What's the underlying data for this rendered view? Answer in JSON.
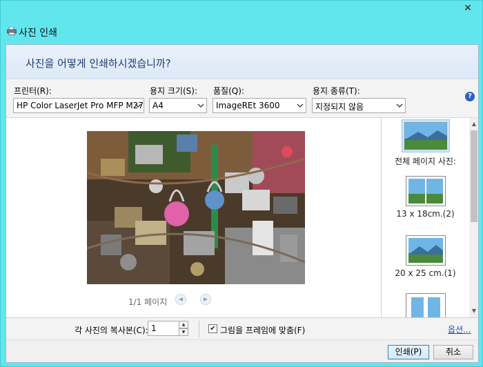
{
  "window": {
    "title": "사진 인쇄",
    "close_glyph": "✕"
  },
  "header": {
    "question": "사진을 어떻게 인쇄하시겠습니까?"
  },
  "controls": {
    "printer": {
      "label": "프린터(R):",
      "value": "HP Color LaserJet Pro MFP M277"
    },
    "paper_size": {
      "label": "용지 크기(S):",
      "value": "A4"
    },
    "quality": {
      "label": "품질(Q):",
      "value": "ImageREt 3600"
    },
    "paper_type": {
      "label": "용지 종류(T):",
      "value": "지정되지 않음"
    },
    "help": "?"
  },
  "preview": {
    "page_indicator": "1/1 페이지"
  },
  "layouts": [
    {
      "label": "전체 페이지 사진:"
    },
    {
      "label": "13 x 18cm.(2)"
    },
    {
      "label": "20 x 25 cm.(1)"
    },
    {
      "label": ""
    }
  ],
  "copies": {
    "label": "각 사진의 복사본(C):",
    "value": "1",
    "fit_label": "그림을 프레임에 맞춤(F)",
    "fit_checked": true,
    "options_link": "옵션..."
  },
  "buttons": {
    "print": "인쇄(P)",
    "cancel": "취소"
  }
}
